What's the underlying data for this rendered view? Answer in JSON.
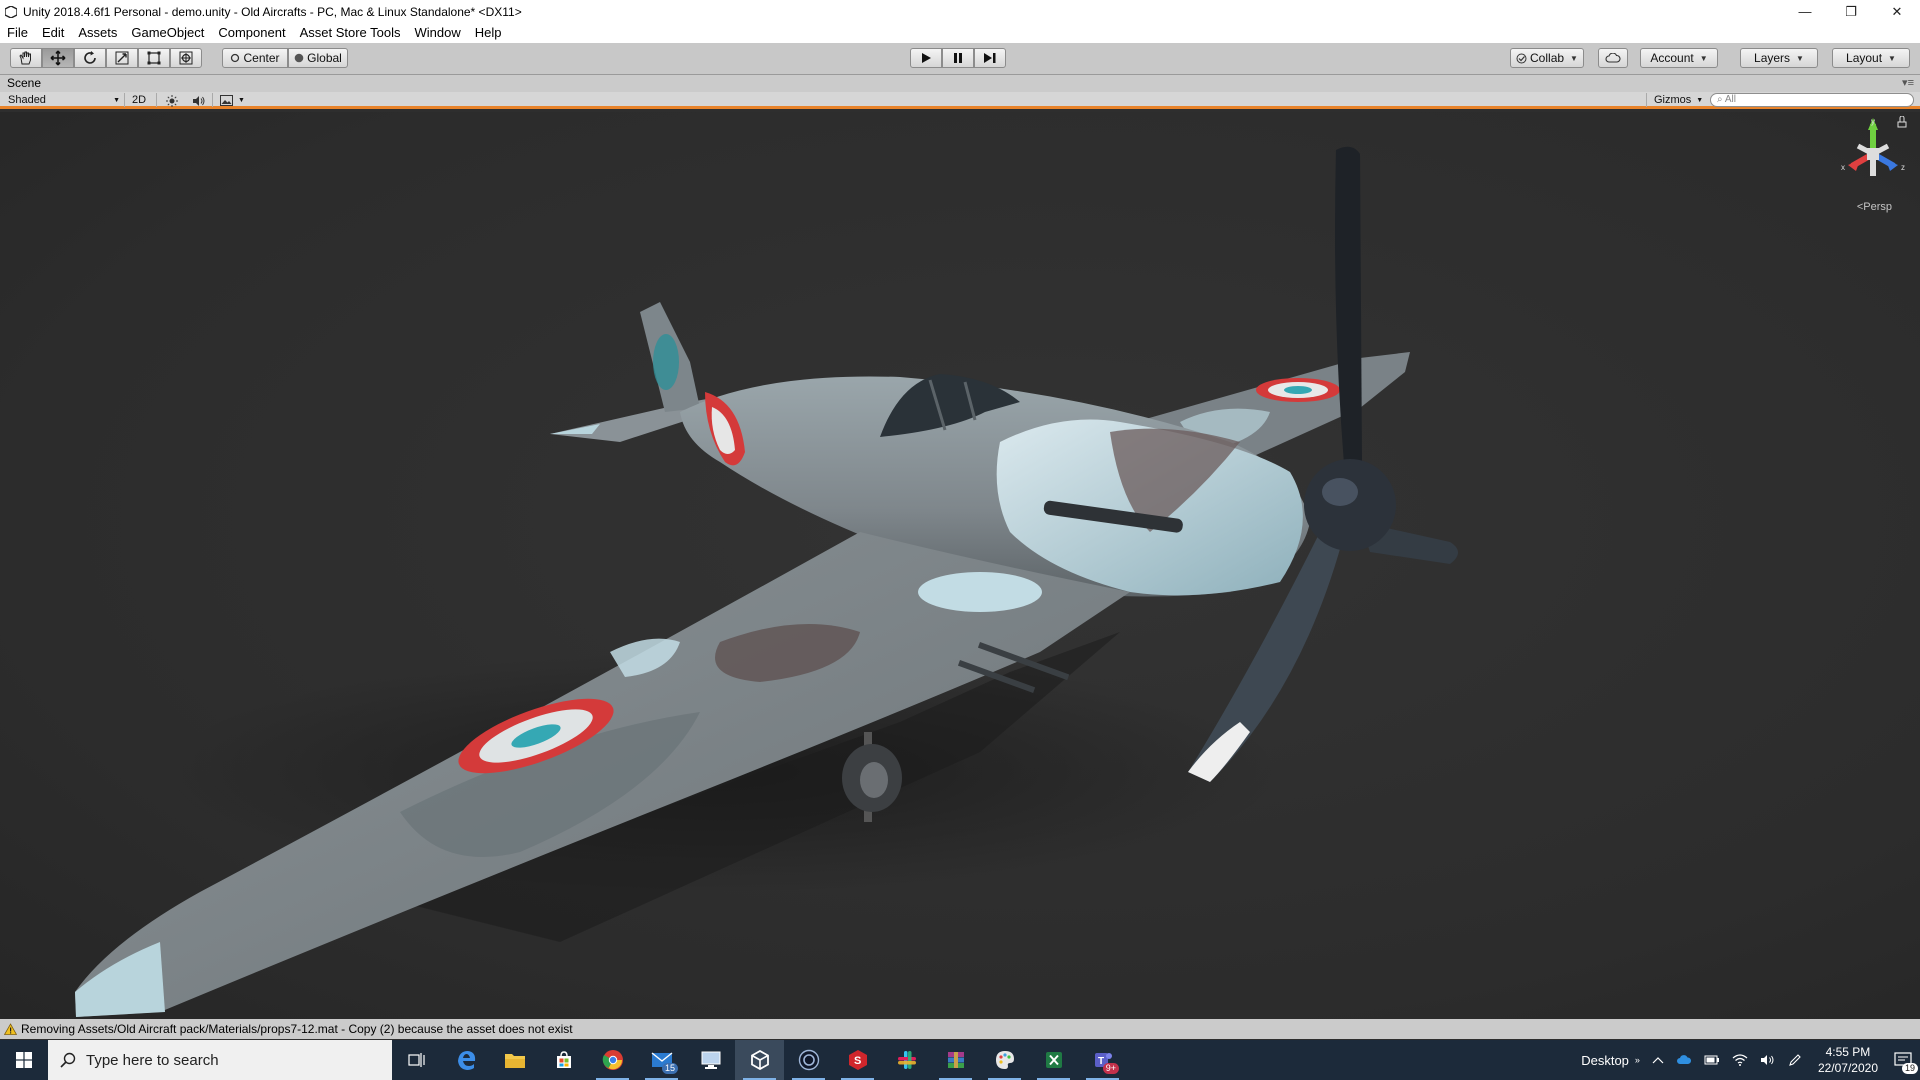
{
  "window": {
    "title": "Unity 2018.4.6f1 Personal - demo.unity - Old Aircrafts - PC, Mac & Linux Standalone* <DX11>",
    "controls": {
      "minimize": "—",
      "restore": "❐",
      "close": "✕"
    }
  },
  "menu": [
    "File",
    "Edit",
    "Assets",
    "GameObject",
    "Component",
    "Asset Store Tools",
    "Window",
    "Help"
  ],
  "toolbar": {
    "tools": [
      "hand-tool",
      "move-tool",
      "rotate-tool",
      "scale-tool",
      "rect-tool",
      "transform-tool"
    ],
    "active_tool": "move-tool",
    "pivot_label": "Center",
    "space_label": "Global",
    "collab_label": "Collab",
    "account_label": "Account",
    "layers_label": "Layers",
    "layout_label": "Layout"
  },
  "scene": {
    "tab_label": "Scene",
    "shading_mode": "Shaded",
    "mode_2d_label": "2D",
    "gizmos_label": "Gizmos",
    "search_placeholder": "All",
    "projection_label": "Persp",
    "axis_x": "x",
    "axis_y": "y",
    "axis_z": "z"
  },
  "status": {
    "message": "Removing Assets/Old Aircraft pack/Materials/props7-12.mat - Copy (2) because the asset does not exist"
  },
  "taskbar": {
    "search_placeholder": "Type here to search",
    "mail_badge": "15",
    "teams_badge": "9+",
    "desktop_label": "Desktop",
    "time": "4:55 PM",
    "date": "22/07/2020",
    "notifications_count": "19"
  },
  "colors": {
    "accent_orange": "#e8832a",
    "viewport_bg": "#2e2e2e",
    "taskbar_bg": "#1c2a3a"
  }
}
